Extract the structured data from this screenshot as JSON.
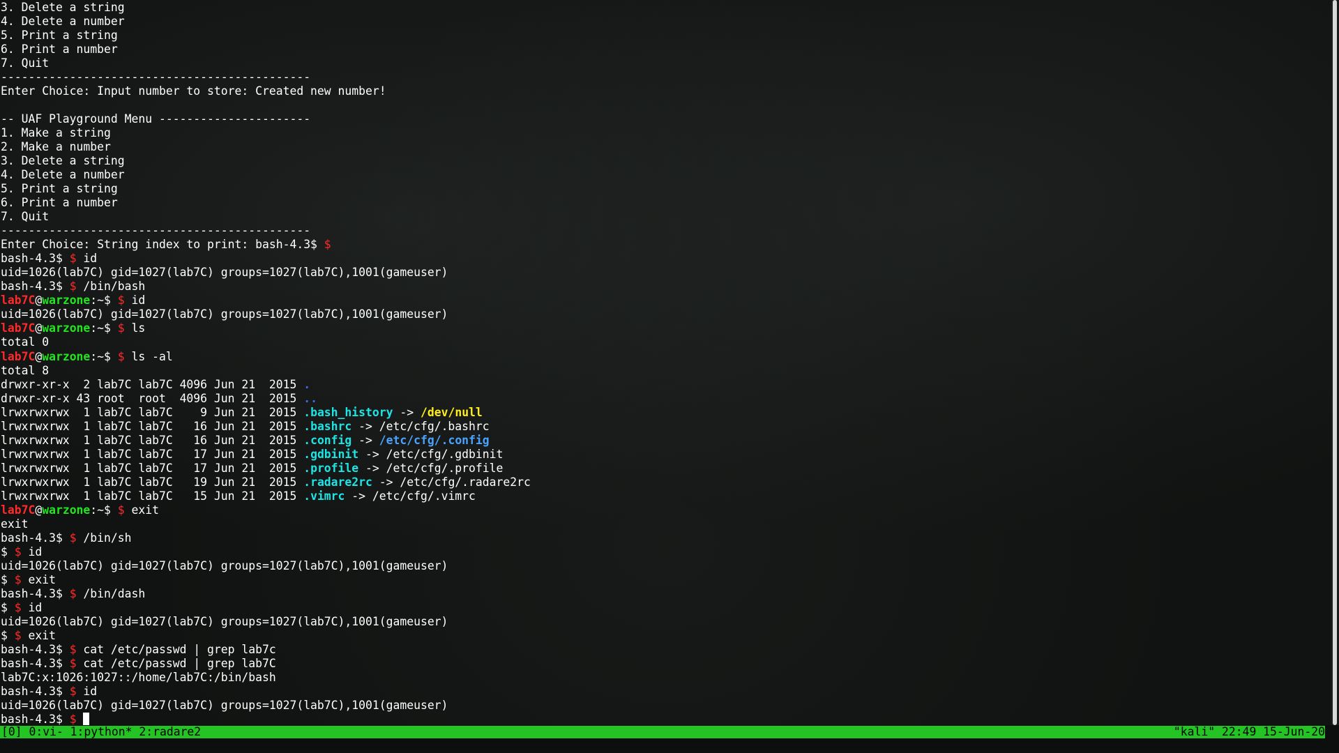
{
  "terminal": {
    "lines": [
      [
        [
          "3. Delete a string",
          "default"
        ]
      ],
      [
        [
          "4. Delete a number",
          "default"
        ]
      ],
      [
        [
          "5. Print a string",
          "default"
        ]
      ],
      [
        [
          "6. Print a number",
          "default"
        ]
      ],
      [
        [
          "7. Quit",
          "default"
        ]
      ],
      [
        [
          "---------------------------------------------",
          "default"
        ]
      ],
      [
        [
          "Enter Choice: Input number to store: Created new number!",
          "default"
        ]
      ],
      [],
      [
        [
          "-- UAF Playground Menu ----------------------",
          "default"
        ]
      ],
      [
        [
          "1. Make a string",
          "default"
        ]
      ],
      [
        [
          "2. Make a number",
          "default"
        ]
      ],
      [
        [
          "3. Delete a string",
          "default"
        ]
      ],
      [
        [
          "4. Delete a number",
          "default"
        ]
      ],
      [
        [
          "5. Print a string",
          "default"
        ]
      ],
      [
        [
          "6. Print a number",
          "default"
        ]
      ],
      [
        [
          "7. Quit",
          "default"
        ]
      ],
      [
        [
          "---------------------------------------------",
          "default"
        ]
      ],
      [
        [
          "Enter Choice: String index to print: bash-4.3$ ",
          "default"
        ],
        [
          "$",
          "red"
        ]
      ],
      [
        [
          "bash-4.3$ ",
          "default"
        ],
        [
          "$",
          "red"
        ],
        [
          " id",
          "default"
        ]
      ],
      [
        [
          "uid=1026(lab7C) gid=1027(lab7C) groups=1027(lab7C),1001(gameuser)",
          "default"
        ]
      ],
      [
        [
          "bash-4.3$ ",
          "default"
        ],
        [
          "$",
          "red"
        ],
        [
          " /bin/bash",
          "default"
        ]
      ],
      [
        [
          "lab7C",
          "red-bold"
        ],
        [
          "@",
          "default"
        ],
        [
          "warzone",
          "green-bold"
        ],
        [
          ":~$ ",
          "default"
        ],
        [
          "$",
          "red"
        ],
        [
          " id",
          "default"
        ]
      ],
      [
        [
          "uid=1026(lab7C) gid=1027(lab7C) groups=1027(lab7C),1001(gameuser)",
          "default"
        ]
      ],
      [
        [
          "lab7C",
          "red-bold"
        ],
        [
          "@",
          "default"
        ],
        [
          "warzone",
          "green-bold"
        ],
        [
          ":~$ ",
          "default"
        ],
        [
          "$",
          "red"
        ],
        [
          " ls",
          "default"
        ]
      ],
      [
        [
          "total 0",
          "default"
        ]
      ],
      [
        [
          "lab7C",
          "red-bold"
        ],
        [
          "@",
          "default"
        ],
        [
          "warzone",
          "green-bold"
        ],
        [
          ":~$ ",
          "default"
        ],
        [
          "$",
          "red"
        ],
        [
          " ls -al",
          "default"
        ]
      ],
      [
        [
          "total 8",
          "default"
        ]
      ],
      [
        [
          "drwxr-xr-x  2 lab7C lab7C 4096 Jun 21  2015 ",
          "default"
        ],
        [
          ".",
          "blue-bold"
        ]
      ],
      [
        [
          "drwxr-xr-x 43 root  root  4096 Jun 21  2015 ",
          "default"
        ],
        [
          "..",
          "blue-bold"
        ]
      ],
      [
        [
          "lrwxrwxrwx  1 lab7C lab7C    9 Jun 21  2015 ",
          "default"
        ],
        [
          ".bash_history",
          "cyan-bold"
        ],
        [
          " -> ",
          "default"
        ],
        [
          "/dev/null",
          "yellow-bold"
        ]
      ],
      [
        [
          "lrwxrwxrwx  1 lab7C lab7C   16 Jun 21  2015 ",
          "default"
        ],
        [
          ".bashrc",
          "cyan-bold"
        ],
        [
          " -> /etc/cfg/.bashrc",
          "default"
        ]
      ],
      [
        [
          "lrwxrwxrwx  1 lab7C lab7C   16 Jun 21  2015 ",
          "default"
        ],
        [
          ".config",
          "cyan-bold"
        ],
        [
          " -> ",
          "default"
        ],
        [
          "/etc/cfg/.config",
          "lightblue-bold"
        ]
      ],
      [
        [
          "lrwxrwxrwx  1 lab7C lab7C   17 Jun 21  2015 ",
          "default"
        ],
        [
          ".gdbinit",
          "cyan-bold"
        ],
        [
          " -> /etc/cfg/.gdbinit",
          "default"
        ]
      ],
      [
        [
          "lrwxrwxrwx  1 lab7C lab7C   17 Jun 21  2015 ",
          "default"
        ],
        [
          ".profile",
          "cyan-bold"
        ],
        [
          " -> /etc/cfg/.profile",
          "default"
        ]
      ],
      [
        [
          "lrwxrwxrwx  1 lab7C lab7C   19 Jun 21  2015 ",
          "default"
        ],
        [
          ".radare2rc",
          "cyan-bold"
        ],
        [
          " -> /etc/cfg/.radare2rc",
          "default"
        ]
      ],
      [
        [
          "lrwxrwxrwx  1 lab7C lab7C   15 Jun 21  2015 ",
          "default"
        ],
        [
          ".vimrc",
          "cyan-bold"
        ],
        [
          " -> /etc/cfg/.vimrc",
          "default"
        ]
      ],
      [
        [
          "lab7C",
          "red-bold"
        ],
        [
          "@",
          "default"
        ],
        [
          "warzone",
          "green-bold"
        ],
        [
          ":~$ ",
          "default"
        ],
        [
          "$",
          "red"
        ],
        [
          " exit",
          "default"
        ]
      ],
      [
        [
          "exit",
          "default"
        ]
      ],
      [
        [
          "bash-4.3$ ",
          "default"
        ],
        [
          "$",
          "red"
        ],
        [
          " /bin/sh",
          "default"
        ]
      ],
      [
        [
          "$ ",
          "default"
        ],
        [
          "$",
          "red"
        ],
        [
          " id",
          "default"
        ]
      ],
      [
        [
          "uid=1026(lab7C) gid=1027(lab7C) groups=1027(lab7C),1001(gameuser)",
          "default"
        ]
      ],
      [
        [
          "$ ",
          "default"
        ],
        [
          "$",
          "red"
        ],
        [
          " exit",
          "default"
        ]
      ],
      [
        [
          "bash-4.3$ ",
          "default"
        ],
        [
          "$",
          "red"
        ],
        [
          " /bin/dash",
          "default"
        ]
      ],
      [
        [
          "$ ",
          "default"
        ],
        [
          "$",
          "red"
        ],
        [
          " id",
          "default"
        ]
      ],
      [
        [
          "uid=1026(lab7C) gid=1027(lab7C) groups=1027(lab7C),1001(gameuser)",
          "default"
        ]
      ],
      [
        [
          "$ ",
          "default"
        ],
        [
          "$",
          "red"
        ],
        [
          " exit",
          "default"
        ]
      ],
      [
        [
          "bash-4.3$ ",
          "default"
        ],
        [
          "$",
          "red"
        ],
        [
          " cat /etc/passwd | grep lab7c",
          "default"
        ]
      ],
      [
        [
          "bash-4.3$ ",
          "default"
        ],
        [
          "$",
          "red"
        ],
        [
          " cat /etc/passwd | grep lab7C",
          "default"
        ]
      ],
      [
        [
          "lab7C:x:1026:1027::/home/lab7C:/bin/bash",
          "default"
        ]
      ],
      [
        [
          "bash-4.3$ ",
          "default"
        ],
        [
          "$",
          "red"
        ],
        [
          " id",
          "default"
        ]
      ],
      [
        [
          "uid=1026(lab7C) gid=1027(lab7C) groups=1027(lab7C),1001(gameuser)",
          "default"
        ]
      ],
      [
        [
          "bash-4.3$ ",
          "default"
        ],
        [
          "$",
          "red"
        ],
        [
          " ",
          "default"
        ]
      ]
    ]
  },
  "statusbar": {
    "left": "[0] 0:vi- 1:python* 2:radare2",
    "right": "\"kali\" 22:49 15-Jun-20",
    "color": "#25c425"
  },
  "colors": {
    "default": "#ffffff",
    "red": "#ff2a2a",
    "green": "#21e51f",
    "blue": "#3a6df0",
    "lightblue": "#4aa3ff",
    "cyan": "#1ee4e4",
    "yellow": "#ffee1a"
  }
}
